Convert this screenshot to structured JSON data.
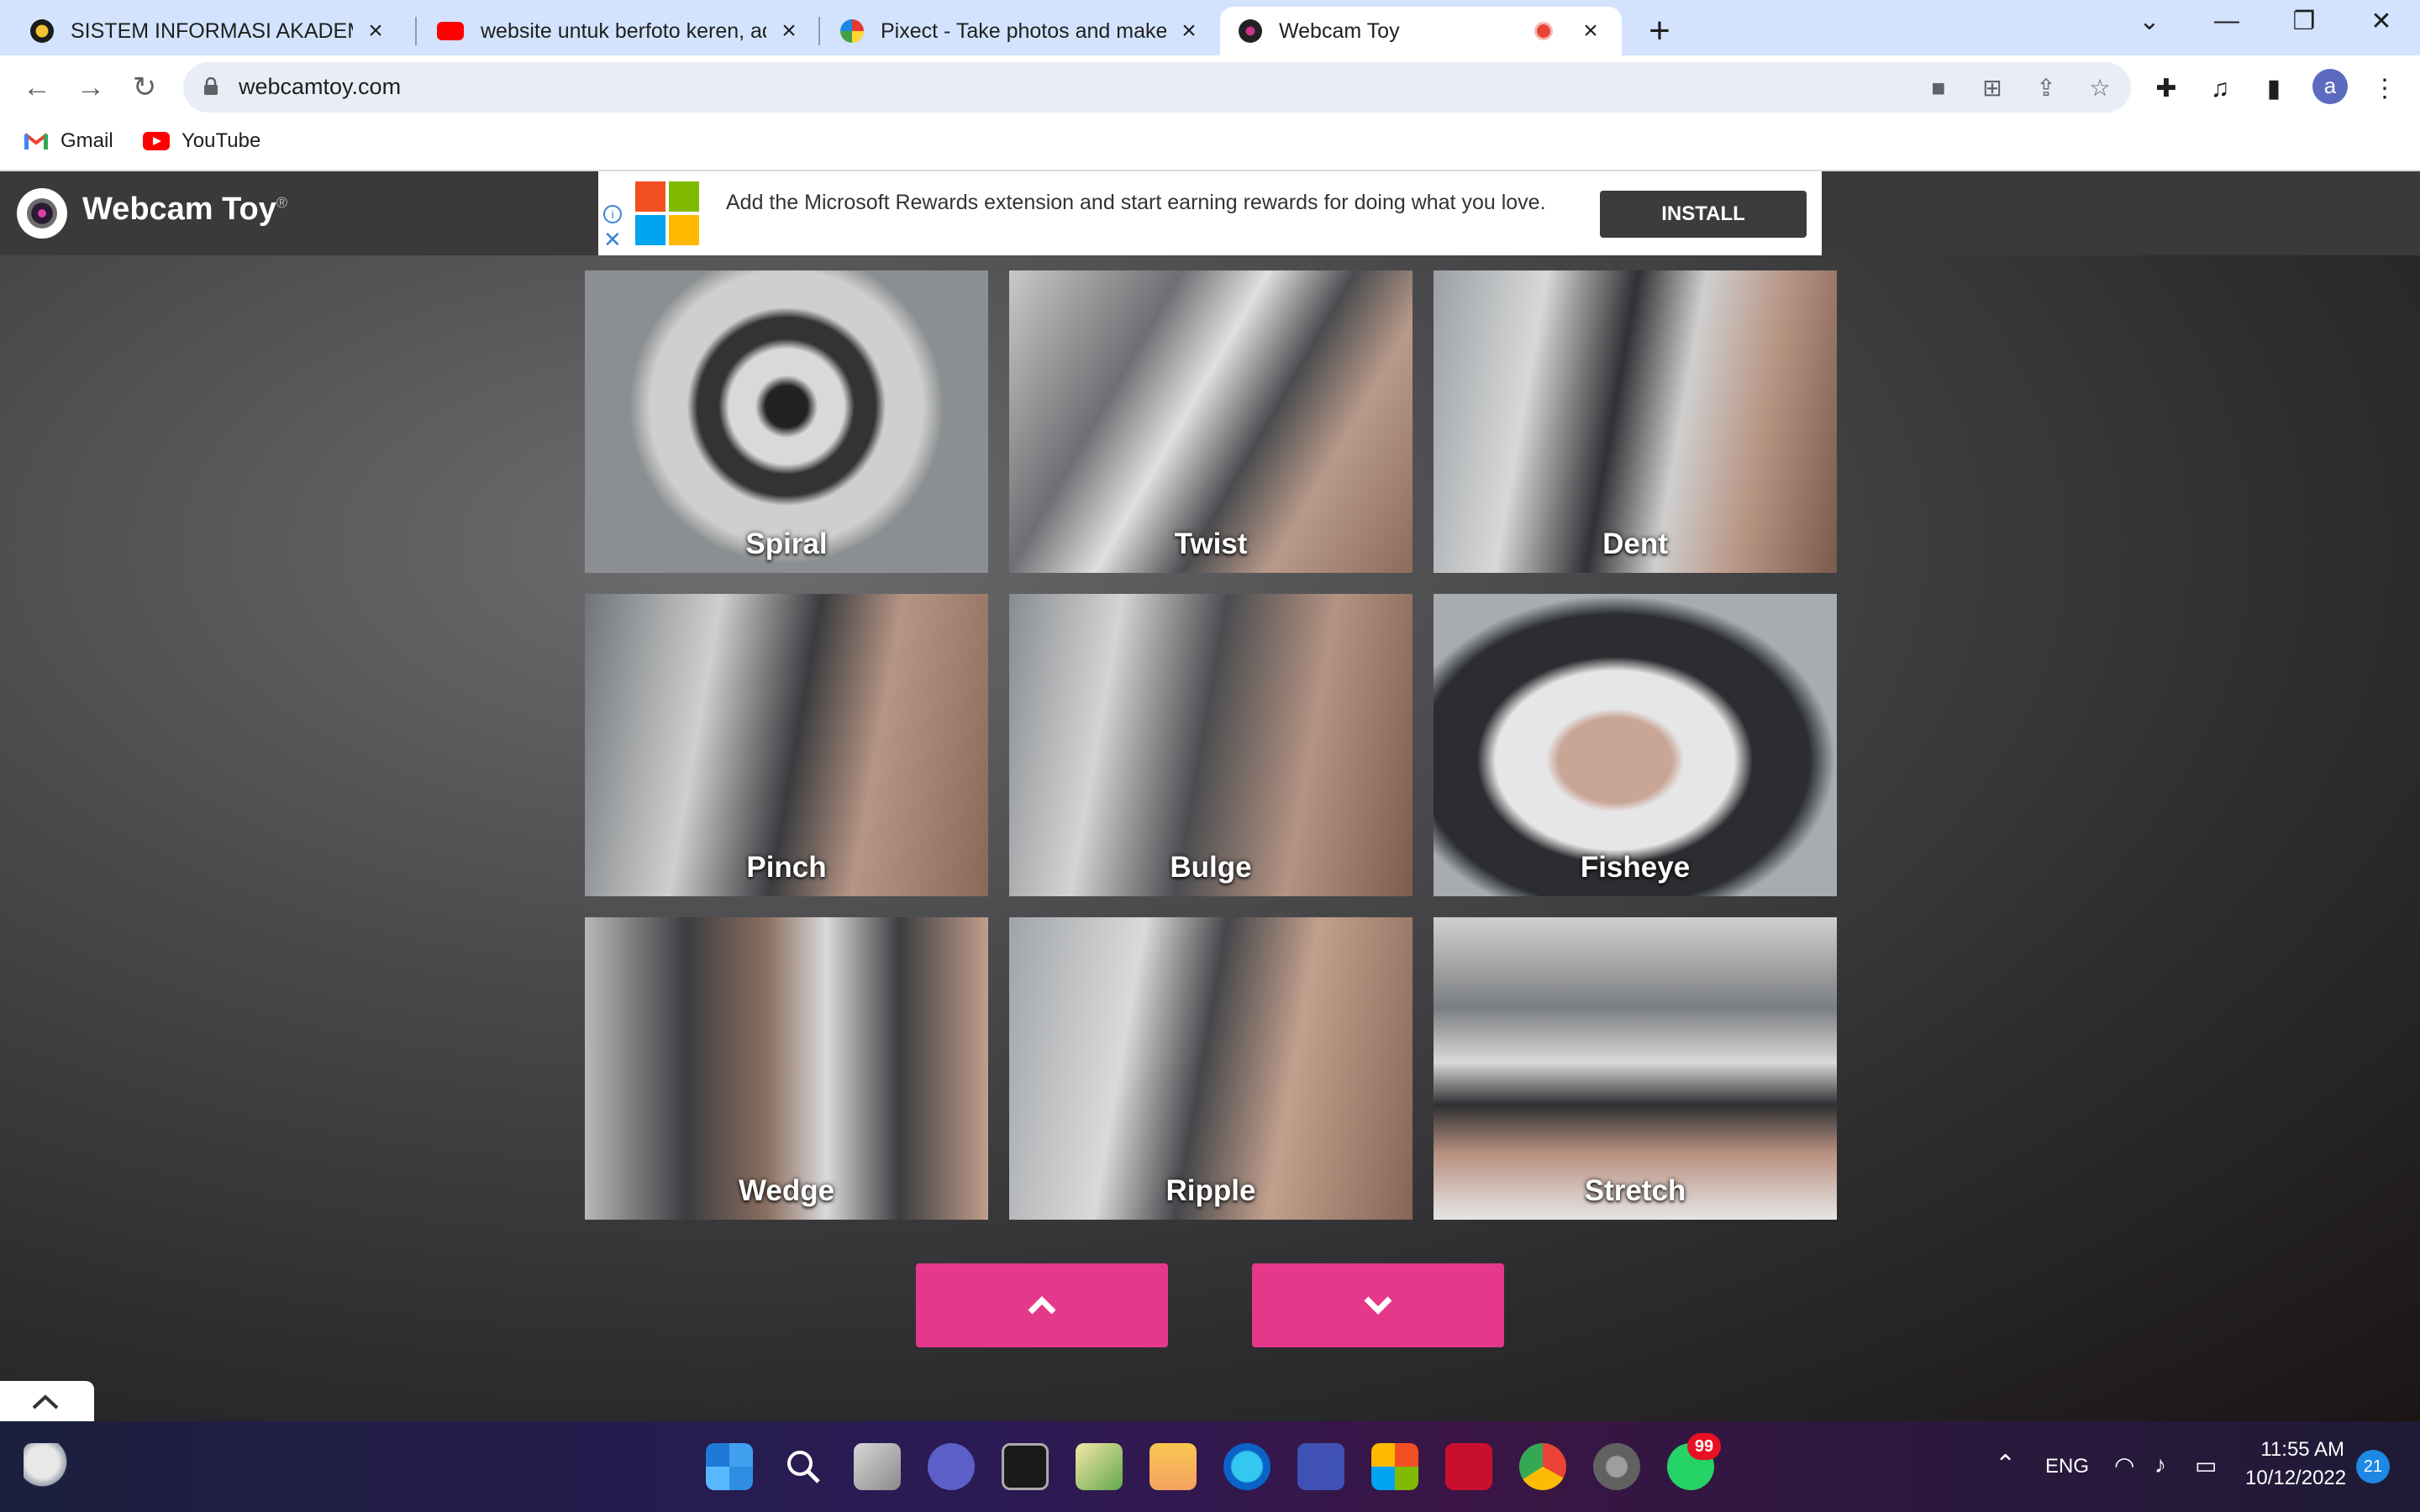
{
  "browser": {
    "tabs": [
      {
        "title": "SISTEM INFORMASI AKADEMIK",
        "icon": "university-crest-icon",
        "active": false
      },
      {
        "title": "website untuk berfoto keren, ada",
        "icon": "youtube-icon",
        "active": false
      },
      {
        "title": "Pixect - Take photos and make vi",
        "icon": "pixect-icon",
        "active": false
      },
      {
        "title": "Webcam Toy",
        "icon": "webcamtoy-icon",
        "active": true,
        "recording": true
      }
    ],
    "new_tab_label": "+",
    "url": "webcamtoy.com",
    "profile_initial": "a",
    "bookmarks": [
      {
        "label": "Gmail",
        "icon": "gmail-icon"
      },
      {
        "label": "YouTube",
        "icon": "youtube-icon"
      }
    ]
  },
  "site": {
    "title": "Webcam Toy",
    "trademark": "®",
    "ad": {
      "text": "Add the Microsoft Rewards extension and start earning rewards for doing what you love.",
      "button": "INSTALL",
      "logo_colors": [
        "#f25022",
        "#7fba00",
        "#00a4ef",
        "#ffb900"
      ]
    },
    "effects": [
      "Spiral",
      "Twist",
      "Dent",
      "Pinch",
      "Bulge",
      "Fisheye",
      "Wedge",
      "Ripple",
      "Stretch"
    ],
    "pager_color": "#e6388a"
  },
  "taskbar": {
    "language": "ENG",
    "time": "11:55 AM",
    "date": "10/12/2022",
    "whatsapp_badge": "99",
    "notification_count": "21"
  }
}
